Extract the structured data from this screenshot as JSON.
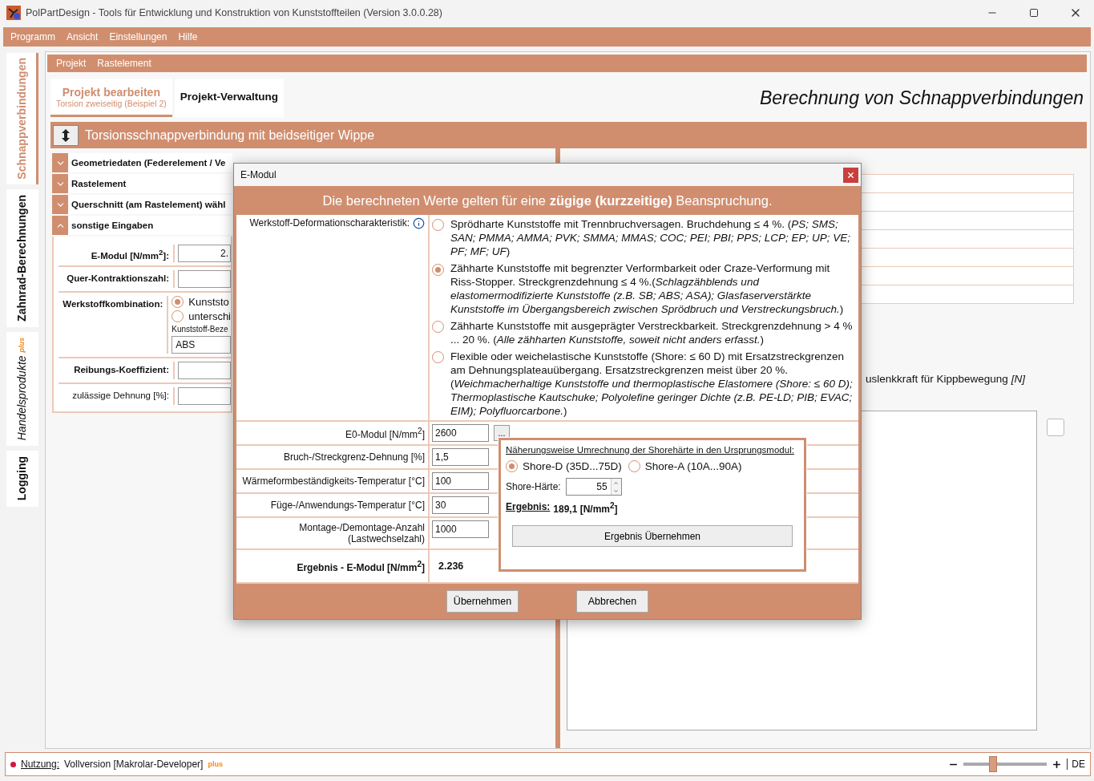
{
  "window": {
    "title": "PolPartDesign - Tools für Entwicklung und Konstruktion von Kunststoffteilen (Version 3.0.0.28)"
  },
  "menu": [
    "Programm",
    "Ansicht",
    "Einstellungen",
    "Hilfe"
  ],
  "side_tabs": [
    {
      "label": "Schnappverbindungen",
      "selected": true
    },
    {
      "label": "Zahnrad-Berechnungen",
      "selected": false
    },
    {
      "label": "Handelsprodukte",
      "badge": "plus",
      "selected": false
    },
    {
      "label": "Logging",
      "selected": false
    }
  ],
  "sub_menu": [
    "Projekt",
    "Rastelement"
  ],
  "project_tabs": [
    {
      "label": "Projekt bearbeiten",
      "subtitle": "Torsion zweiseitig (Beispiel 2)",
      "selected": true
    },
    {
      "label": "Projekt-Verwaltung",
      "selected": false
    }
  ],
  "page_heading": "Berechnung von Schnappverbindungen",
  "section_title": "Torsionsschnappverbindung mit beidseitiger Wippe",
  "accordion": [
    {
      "title": "Geometriedaten (Federelement / Ve",
      "expanded": false
    },
    {
      "title": "Rastelement",
      "expanded": false
    },
    {
      "title": "Querschnitt (am Rastelement) wähl",
      "expanded": false
    },
    {
      "title": "sonstige Eingaben",
      "expanded": true
    }
  ],
  "inputs": [
    {
      "kind": "field",
      "label": "E-Modul [N/mm$^{2}$]:",
      "bold": true,
      "value": "2."
    },
    {
      "kind": "field",
      "label": "Quer-Kontraktionszahl:",
      "bold": true
    },
    {
      "kind": "radios",
      "label": "Werkstoffkombination:",
      "bold": true,
      "options": [
        {
          "label": "Kunststo",
          "selected": true
        },
        {
          "label": "unterschi",
          "selected": false
        }
      ],
      "sub_label": "Kunststoff-Beze",
      "sub_value": "ABS"
    },
    {
      "kind": "field",
      "label": "Reibungs-Koeffizient:",
      "bold": true
    },
    {
      "kind": "field",
      "label": "zulässige Dehnung [%]:",
      "bold": false
    }
  ],
  "result_text": "uslenkkraft für Kippbewegung *[N]*",
  "chart_checkbox": {
    "checked": false
  },
  "dialog": {
    "title": "E-Modul",
    "banner": "Die berechneten Werte gelten für eine **zügige (kurzzeitige)** Beanspruchung.",
    "deformation_label": "Werkstoff-Deformationscharakteristik:",
    "deformation_options": [
      {
        "text": "Sprödharte Kunststoffe mit Trennbruchversagen. Bruchdehung ≤ 4 %. (*PS; SMS; SAN; PMMA; AMMA; PVK; SMMA; MMAS; COC; PEI; PBI; PPS; LCP; EP; UP; VE; PF; MF; UF*)",
        "selected": false
      },
      {
        "text": "Zähharte Kunststoffe mit begrenzter Verformbarkeit oder Craze-Verformung mit Riss-Stopper. Streckgrenzdehnung ≤ 4 %.(*Schlagzähblends und elastomermodifizierte Kunststoffe (z.B. SB; ABS; ASA); Glasfaserverstärkte Kunststoffe im Übergangsbereich zwischen Sprödbruch und Verstreckungsbruch.*)",
        "selected": true
      },
      {
        "text": "Zähharte Kunststoffe mit ausgeprägter Verstreckbarkeit. Streckgrenzdehnung > 4 % ... 20 %. (*Alle zähharten Kunststoffe, soweit nicht anders erfasst.*)",
        "selected": false
      },
      {
        "text": "Flexible oder weichelastische Kunststoffe (Shore: ≤ 60 D) mit Ersatzstreckgrenzen am Dehnungsplateauübergang. Ersatzstreckgrenzen meist über 20 %. (*Weichmacherhaltige Kunststoffe und thermoplastische Elastomere (Shore: ≤ 60 D); Thermoplastische Kautschuke; Polyolefine geringer Dichte (z.B. PE-LD; PIB; EVAC; EIM); Polyfluorcarbone.*)",
        "selected": false
      }
    ],
    "fields": [
      {
        "label": "E0-Modul [N/mm$^{2}$]",
        "value": "2600",
        "button": "..."
      },
      {
        "label": "Bruch-/Streckgrenz-Dehnung [%]",
        "value": "1,5"
      },
      {
        "label": "Wärmeformbeständigkeits-Temperatur [°C]",
        "value": "100"
      },
      {
        "label": "Füge-/Anwendungs-Temperatur [°C]",
        "value": "30"
      },
      {
        "label": "Montage-/Demontage-Anzahl",
        "sublabel": "(Lastwechselzahl)",
        "value": "1000"
      }
    ],
    "result": {
      "label": "Ergebnis - E-Modul [N/mm$^{2}$]",
      "value": "2.236"
    },
    "shore": {
      "title": "Näherungsweise Umrechnung der Shorehärte in den Ursprungsmodul:",
      "options": [
        {
          "label": "Shore-D (35D...75D)",
          "selected": true
        },
        {
          "label": "Shore-A (10A...90A)",
          "selected": false
        }
      ],
      "hardness_label": "Shore-Härte:",
      "hardness_value": "55",
      "result_label": "Ergebnis:",
      "result_value": "189,1 [N/mm$^{2}$]",
      "button": "Ergebnis Übernehmen"
    },
    "buttons": [
      "Übernehmen",
      "Abbrechen"
    ]
  },
  "status_bar": {
    "label": "Nutzung:",
    "value": "Vollversion [Makrolar-Developer]",
    "badge": "plus",
    "zoom": {
      "level": 0.34
    },
    "language": "DE"
  }
}
